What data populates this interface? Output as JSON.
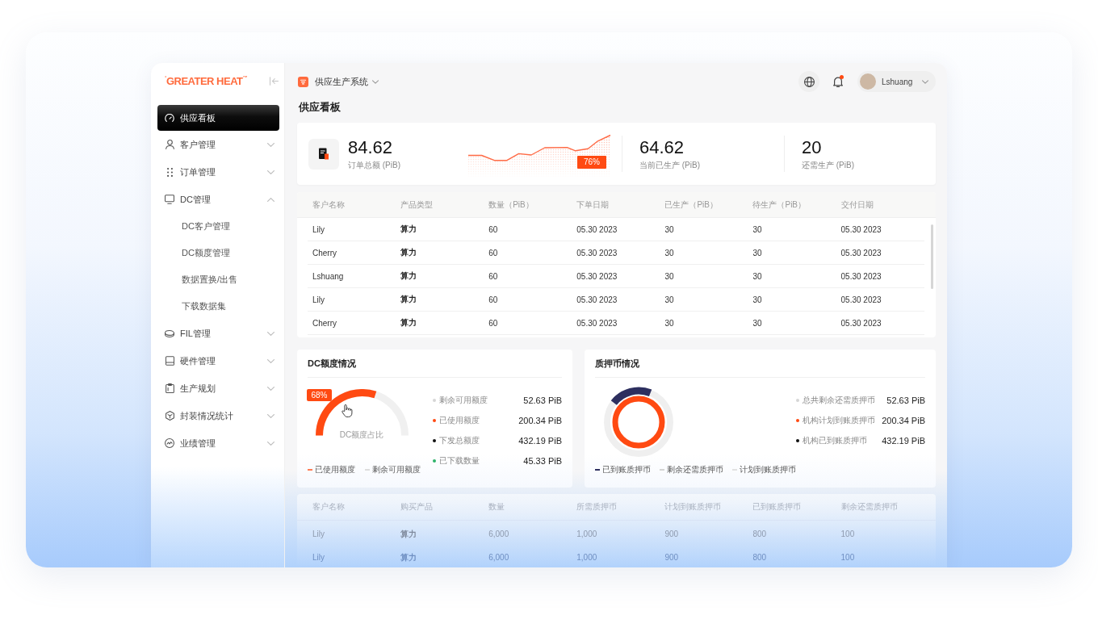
{
  "logo": {
    "text": "$^{°}$GREATER HEAT$^{™}$"
  },
  "sidebar": {
    "items": [
      {
        "label": "供应看板",
        "selected": true
      },
      {
        "label": "客户管理",
        "selected": false,
        "expanded": false
      },
      {
        "label": "订单管理",
        "selected": false,
        "expanded": false
      },
      {
        "label": "DC管理",
        "selected": false,
        "expanded": true,
        "children": [
          {
            "label": "DC客户管理",
            "selected": false
          },
          {
            "label": "DC额度管理",
            "selected": false
          },
          {
            "label": "数据置换/出售",
            "selected": false
          },
          {
            "label": "下载数据集",
            "selected": false
          }
        ]
      },
      {
        "label": "FIL管理",
        "selected": false,
        "expanded": false
      },
      {
        "label": "硬件管理",
        "selected": false,
        "expanded": false
      },
      {
        "label": "生产规划",
        "selected": false,
        "expanded": false
      },
      {
        "label": "封装情况统计",
        "selected": false,
        "expanded": false
      },
      {
        "label": "业绩管理",
        "selected": false,
        "expanded": false
      }
    ]
  },
  "topbar": {
    "system": "供应生产系统",
    "notifications": {
      "unread": true
    },
    "user": {
      "name": "Lshuang"
    }
  },
  "page_title": "供应看板",
  "summary": {
    "metrics": [
      {
        "kind": "trend",
        "value": "84.62",
        "label": "订单总额 (PiB)",
        "badge": "76%"
      },
      {
        "kind": "plain",
        "value": "64.62",
        "label": "当前已生产 (PiB)"
      },
      {
        "kind": "plain",
        "value": "20",
        "label": "还需生产 (PiB)"
      }
    ]
  },
  "orders_table": {
    "columns": [
      "客户名称",
      "产品类型",
      "数量（PiB）",
      "下单日期",
      "已生产（PiB）",
      "待生产（PiB）",
      "交付日期"
    ],
    "rows": [
      [
        "Lily",
        "算力",
        "60",
        "05.30 2023",
        "30",
        "30",
        "05.30 2023"
      ],
      [
        "Cherry",
        "算力",
        "60",
        "05.30 2023",
        "30",
        "30",
        "05.30 2023"
      ],
      [
        "Lshuang",
        "算力",
        "60",
        "05.30 2023",
        "30",
        "30",
        "05.30 2023"
      ],
      [
        "Lily",
        "算力",
        "60",
        "05.30 2023",
        "30",
        "30",
        "05.30 2023"
      ],
      [
        "Cherry",
        "算力",
        "60",
        "05.30 2023",
        "30",
        "30",
        "05.30 2023"
      ]
    ]
  },
  "dc_quota": {
    "title": "DC额度情况",
    "gauge": {
      "level": 0.6,
      "badge": "68%",
      "caption": "DC额度占比"
    },
    "legend": [
      {
        "label": "已使用额度",
        "color": "#ff7d55"
      },
      {
        "label": "剩余可用额度",
        "color": "#dddddd"
      }
    ],
    "stats": [
      {
        "label": "剩余可用额度",
        "value": "52.63 PiB",
        "color": "#d6d6d6"
      },
      {
        "label": "已使用额度",
        "value": "200.34 PiB",
        "color": "#ff4a12"
      },
      {
        "label": "下发总额度",
        "value": "432.19 PiB",
        "color": "#111111"
      },
      {
        "label": "已下载数量",
        "value": "45.33 PiB",
        "color": "#2fb36a"
      }
    ]
  },
  "pledge": {
    "title": "质押币情况",
    "legend": [
      {
        "label": "已到账质押币",
        "color": "#2d2f5f"
      },
      {
        "label": "剩余还需质押币",
        "color": "#d4d4d4"
      },
      {
        "label": "计划到账质押币",
        "color": "#e2e2e2"
      }
    ],
    "stats": [
      {
        "label": "总共剩余还需质押币",
        "value": "52.63 PiB",
        "color": "#d6d6d6"
      },
      {
        "label": "机构计划到账质押币",
        "value": "200.34 PiB",
        "color": "#ff4a12"
      },
      {
        "label": "机构已到账质押币",
        "value": "432.19 PiB",
        "color": "#111111"
      }
    ]
  },
  "pledge_table": {
    "columns": [
      "客户名称",
      "购买产品",
      "数量",
      "所需质押币",
      "计划到账质押币",
      "已到账质押币",
      "剩余还需质押币"
    ],
    "rows": [
      [
        "Lily",
        "算力",
        "6,000",
        "1,000",
        "900",
        "800",
        "100"
      ],
      [
        "Lily",
        "算力",
        "6,000",
        "1,000",
        "900",
        "800",
        "100"
      ]
    ]
  }
}
